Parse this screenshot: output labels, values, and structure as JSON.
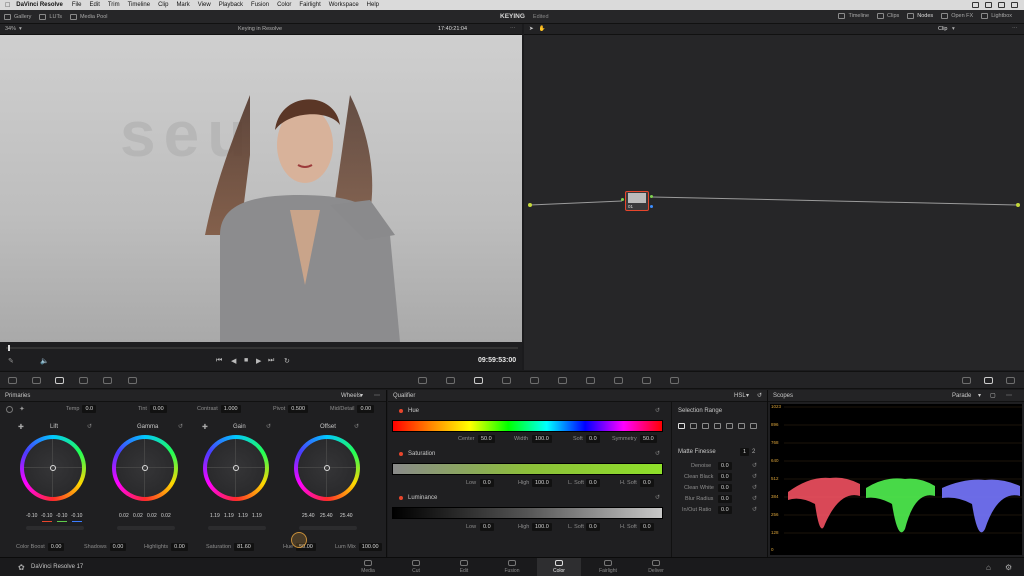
{
  "menubar": {
    "app": "DaVinci Resolve",
    "items": [
      "File",
      "Edit",
      "Trim",
      "Timeline",
      "Clip",
      "Mark",
      "View",
      "Playback",
      "Fusion",
      "Color",
      "Fairlight",
      "Workspace",
      "Help"
    ]
  },
  "toolbar": {
    "left": [
      "Gallery",
      "LUTs",
      "Media Pool"
    ],
    "center_title": "KEYING",
    "center_sub": "Edited",
    "right": [
      "Timeline",
      "Clips",
      "Nodes",
      "Open FX",
      "Lightbox"
    ]
  },
  "viewer": {
    "zoom": "34%",
    "clip_name": "Keying in Resolve",
    "timecode": "17:40:21:04",
    "watermark": "seu"
  },
  "nodes": {
    "mode": "Clip",
    "node_number": "01"
  },
  "transport": {
    "timecode": "09:59:53:00"
  },
  "primaries": {
    "title": "Primaries",
    "mode": "Wheels",
    "top": [
      {
        "label": "Temp",
        "value": "0.0"
      },
      {
        "label": "Tint",
        "value": "0.00"
      },
      {
        "label": "Contrast",
        "value": "1.000"
      },
      {
        "label": "Pivot",
        "value": "0.500"
      },
      {
        "label": "Mid/Detail",
        "value": "0.00"
      }
    ],
    "wheels": [
      {
        "name": "Lift",
        "values": [
          "-0.10",
          "-0.10",
          "-0.10",
          "-0.10"
        ]
      },
      {
        "name": "Gamma",
        "values": [
          "0.02",
          "0.02",
          "0.02",
          "0.02"
        ]
      },
      {
        "name": "Gain",
        "values": [
          "1.19",
          "1.19",
          "1.19",
          "1.19"
        ]
      },
      {
        "name": "Offset",
        "values": [
          "25.40",
          "25.40",
          "25.40"
        ]
      }
    ],
    "bottom": [
      {
        "label": "Color Boost",
        "value": "0.00"
      },
      {
        "label": "Shadows",
        "value": "0.00"
      },
      {
        "label": "Highlights",
        "value": "0.00"
      },
      {
        "label": "Saturation",
        "value": "81.60"
      },
      {
        "label": "Hue",
        "value": "50.00"
      },
      {
        "label": "Lum Mix",
        "value": "100.00"
      }
    ]
  },
  "qualifier": {
    "title": "Qualifier",
    "mode": "HSL",
    "hue": {
      "label": "Hue",
      "center": "50.0",
      "width": "100.0",
      "soft": "0.0",
      "symmetry": "50.0"
    },
    "saturation": {
      "label": "Saturation",
      "low": "0.0",
      "high": "100.0",
      "lsoft": "0.0",
      "hsoft": "0.0"
    },
    "luminance": {
      "label": "Luminance",
      "low": "0.0",
      "high": "100.0",
      "lsoft": "0.0",
      "hsoft": "0.0"
    },
    "labels": {
      "center": "Center",
      "width": "Width",
      "soft": "Soft",
      "symmetry": "Symmetry",
      "low": "Low",
      "high": "High",
      "lsoft": "L. Soft",
      "hsoft": "H. Soft"
    },
    "selection_range": "Selection Range",
    "matte_finesse": {
      "title": "Matte Finesse",
      "p1": "1",
      "p2": "2",
      "items": [
        {
          "label": "Denoise",
          "value": "0.0"
        },
        {
          "label": "Clean Black",
          "value": "0.0"
        },
        {
          "label": "Clean White",
          "value": "0.0"
        },
        {
          "label": "Blur Radius",
          "value": "0.0"
        },
        {
          "label": "In/Out Ratio",
          "value": "0.0"
        }
      ]
    }
  },
  "scopes": {
    "title": "Scopes",
    "mode": "Parade",
    "scale": [
      "1023",
      "896",
      "768",
      "640",
      "512",
      "384",
      "256",
      "128",
      "0"
    ]
  },
  "bottombar": {
    "version": "DaVinci Resolve 17",
    "pages": [
      "Media",
      "Cut",
      "Edit",
      "Fusion",
      "Color",
      "Fairlight",
      "Deliver"
    ],
    "active": "Color"
  },
  "colors": {
    "accent": "#e8462c",
    "active_page_bg": "#2e2e30",
    "node_link": "#8fd14f"
  }
}
